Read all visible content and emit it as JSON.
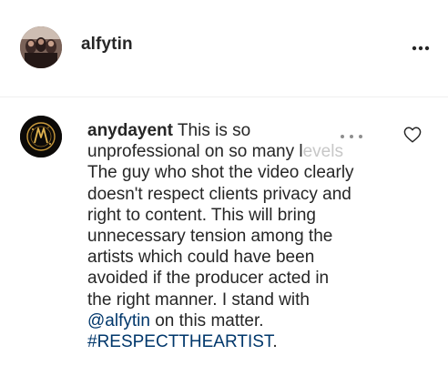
{
  "post": {
    "author": "alfytin",
    "more_icon": "more-horizontal-icon"
  },
  "comment": {
    "author": "anydayent",
    "lines": [
      "This is so",
      "unprofessional on so many l",
      "The guy who shot the video clearly",
      "doesn't respect clients privacy and",
      "right to content. This will bring",
      "unnecessary tension among the",
      "artists which could have been",
      "avoided if the producer acted in",
      "the right manner. I stand with"
    ],
    "faded_fragment": "evels",
    "mention": "@alfytin",
    "after_mention": " on this matter.",
    "hashtag": "#RESPECTTHEARTIST",
    "after_hashtag": ".",
    "like_icon": "heart-outline-icon",
    "options_icon": "more-horizontal-icon"
  },
  "colors": {
    "text": "#262626",
    "link": "#00376b",
    "divider": "#efefef",
    "muted": "#8e8e8e"
  }
}
